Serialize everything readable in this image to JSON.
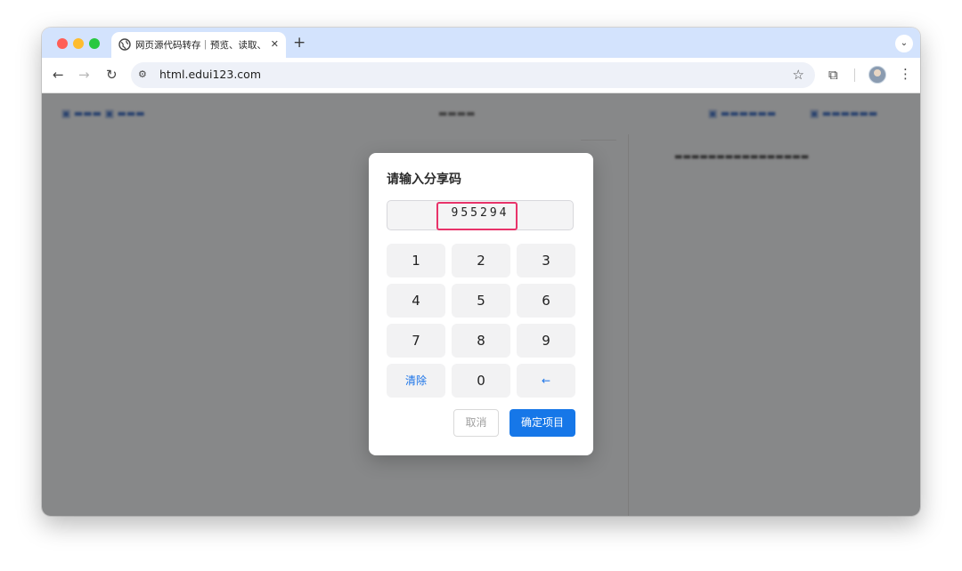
{
  "browser": {
    "tab_title": "网页源代码转存｜预览、读取、",
    "tab_close": "✕",
    "new_tab": "+",
    "tab_menu": "⌄",
    "url": "html.edui123.com",
    "site_info_icon": "⚙",
    "back_icon": "←",
    "forward_icon": "→",
    "reload_icon": "↻",
    "bookmark_icon": "☆",
    "extensions_icon": "⧉",
    "menu_icon": "⋮"
  },
  "dialog": {
    "title": "请输入分享码",
    "code": "955294",
    "keys": {
      "k1": "1",
      "k2": "2",
      "k3": "3",
      "k4": "4",
      "k5": "5",
      "k6": "6",
      "k7": "7",
      "k8": "8",
      "k9": "9",
      "clear": "清除",
      "k0": "0",
      "backspace": "←"
    },
    "cancel_label": "取消",
    "confirm_label": "确定项目"
  },
  "colors": {
    "accent": "#1677e8",
    "highlight": "#e8336a",
    "tabbar": "#d3e3fd"
  }
}
